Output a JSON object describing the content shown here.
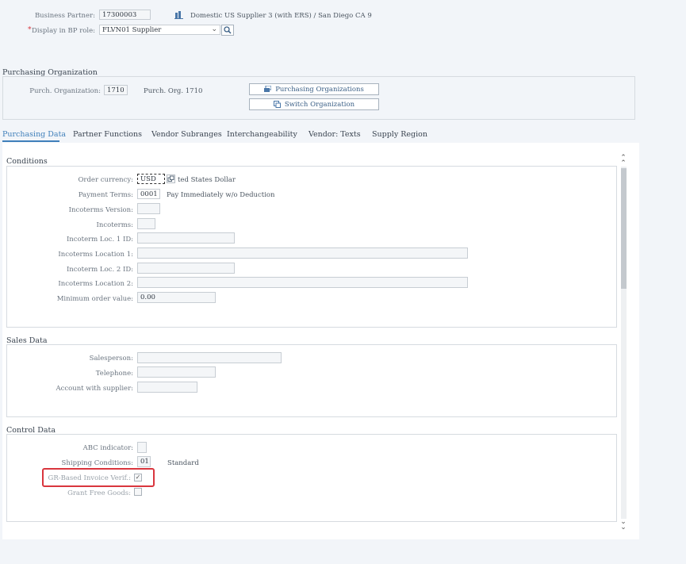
{
  "header": {
    "bp_label": "Business Partner:",
    "bp_value": "17300003",
    "bp_description": "Domestic US Supplier 3 (with ERS) / San Diego CA 9",
    "role_required_mark": "*",
    "role_label": "Display in BP role:",
    "role_value": "FLVN01 Supplier"
  },
  "purch_org": {
    "title": "Purchasing Organization",
    "label": "Purch. Organization:",
    "value": "1710",
    "description": "Purch. Org. 1710",
    "btn_purchasing_orgs": "Purchasing Organizations",
    "btn_switch_org": "Switch Organization"
  },
  "tabs": [
    {
      "label": "Purchasing Data"
    },
    {
      "label": "Partner Functions"
    },
    {
      "label": "Vendor Subranges"
    },
    {
      "label": "Interchangeability"
    },
    {
      "label": "Vendor: Texts"
    },
    {
      "label": "Supply Region"
    }
  ],
  "conditions": {
    "title": "Conditions",
    "order_currency_label": "Order currency:",
    "order_currency_value": "USD",
    "order_currency_desc": "ted States Dollar",
    "payment_terms_label": "Payment Terms:",
    "payment_terms_value": "0001",
    "payment_terms_desc": "Pay Immediately w/o Deduction",
    "incoterms_version_label": "Incoterms Version:",
    "incoterms_version_value": "",
    "incoterms_label": "Incoterms:",
    "incoterms_value": "",
    "loc1_id_label": "Incoterm Loc. 1 ID:",
    "loc1_id_value": "",
    "loc1_label": "Incoterms Location 1:",
    "loc1_value": "",
    "loc2_id_label": "Incoterm Loc. 2 ID:",
    "loc2_id_value": "",
    "loc2_label": "Incoterms Location 2:",
    "loc2_value": "",
    "min_order_label": "Minimum order value:",
    "min_order_value": "0.00"
  },
  "sales": {
    "title": "Sales Data",
    "salesperson_label": "Salesperson:",
    "salesperson_value": "",
    "telephone_label": "Telephone:",
    "telephone_value": "",
    "account_label": "Account with supplier:",
    "account_value": ""
  },
  "control": {
    "title": "Control Data",
    "abc_label": "ABC indicator:",
    "abc_value": "",
    "shipping_label": "Shipping Conditions:",
    "shipping_value": "01",
    "shipping_desc": "Standard",
    "gr_label": "GR-Based Invoice Verif.:",
    "gr_checked": true,
    "gr_mark": "✓",
    "grant_label": "Grant Free Goods:",
    "grant_checked": false
  },
  "colors": {
    "accent": "#3f7fba",
    "highlight": "#d9363e"
  }
}
